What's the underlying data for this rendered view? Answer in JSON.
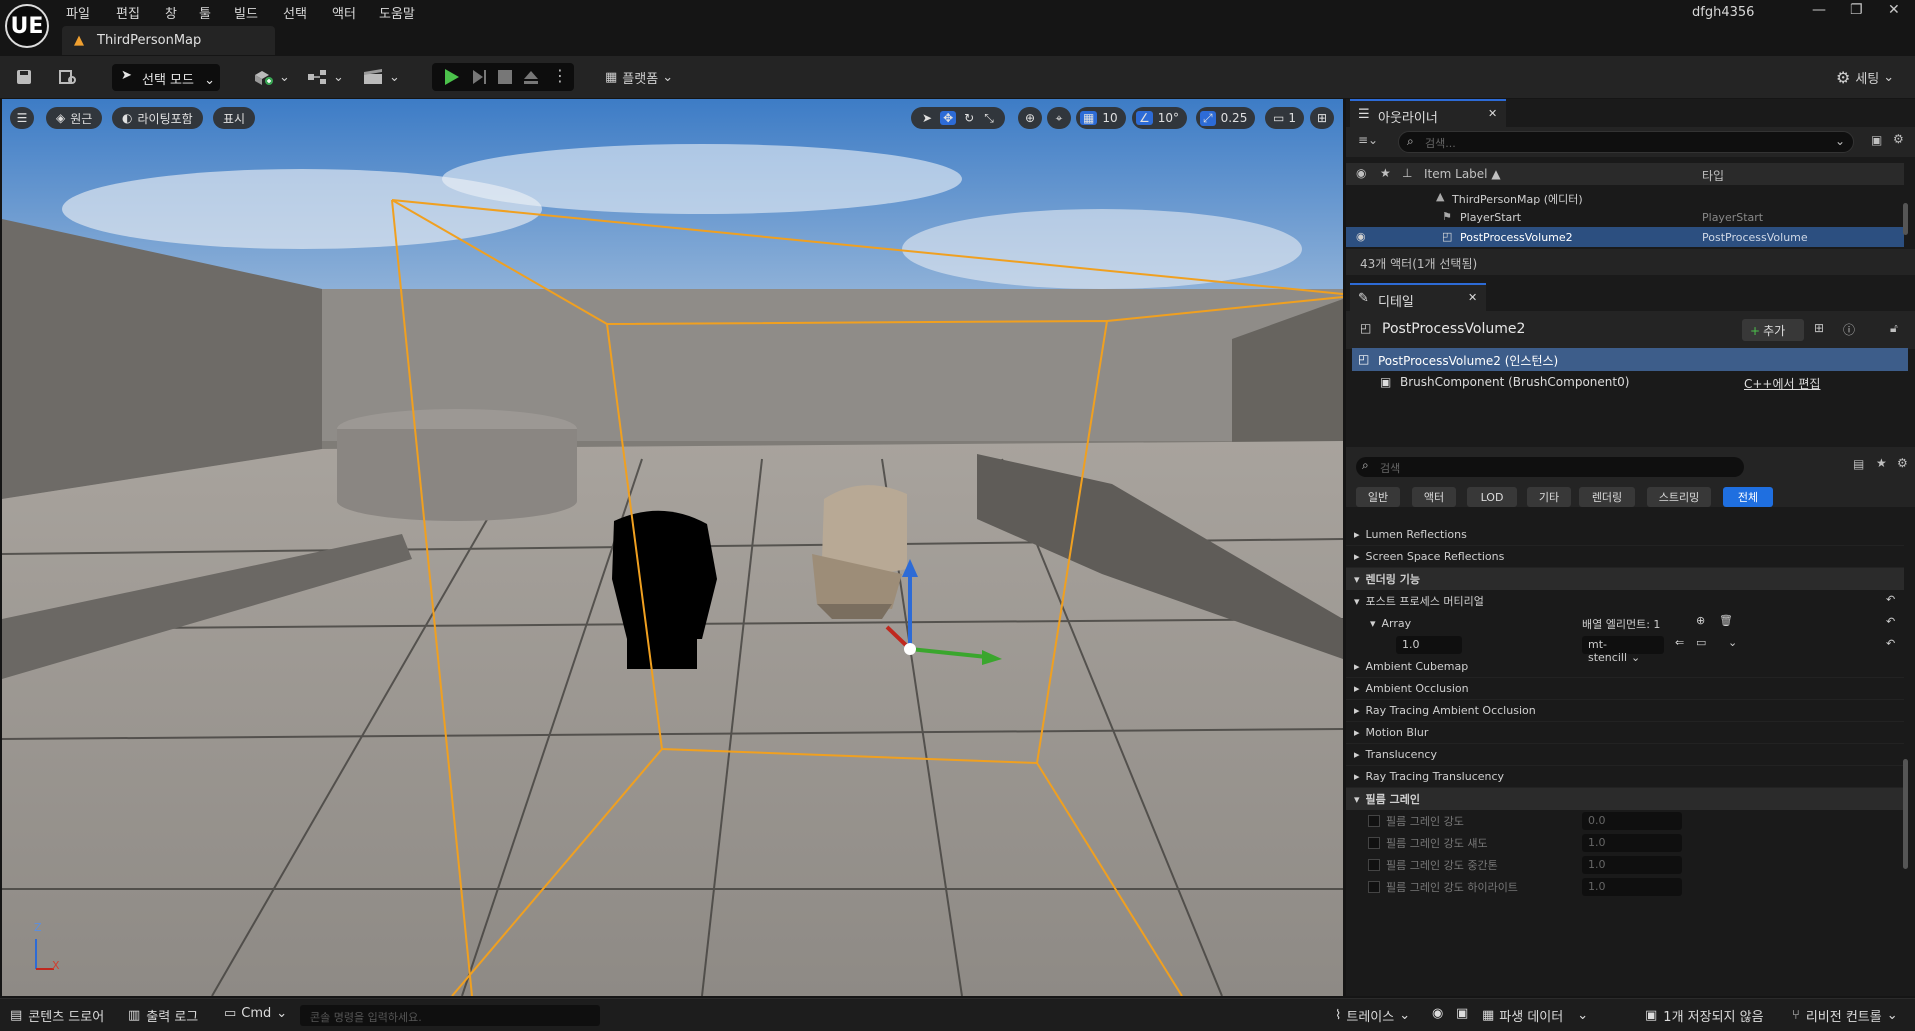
{
  "app": {
    "logo": "UE",
    "menus": [
      "파일",
      "편집",
      "창",
      "툴",
      "빌드",
      "선택",
      "액터",
      "도움말"
    ],
    "user": "dfgh4356",
    "map_tab": "ThirdPersonMap"
  },
  "toolbar": {
    "mode": "선택 모드",
    "platforms": "플랫폼",
    "settings": "세팅"
  },
  "viewport": {
    "perspective": "원근",
    "lit": "라이팅포함",
    "show": "표시",
    "grid_snap": "10",
    "rot_snap": "10°",
    "scale_snap": "0.25",
    "camera_speed": "1",
    "axis_z": "Z",
    "axis_x": "X"
  },
  "outliner": {
    "tab": "아웃라이너",
    "search_placeholder": "검색...",
    "col_label": "Item Label ▲",
    "col_type": "타입",
    "rows": [
      {
        "label": "ThirdPersonMap (에디터)",
        "type": ""
      },
      {
        "label": "PlayerStart",
        "type": "PlayerStart"
      },
      {
        "label": "PostProcessVolume2",
        "type": "PostProcessVolume"
      }
    ],
    "count": "43개 액터(1개 선택됨)"
  },
  "details": {
    "tab": "디테일",
    "object_name": "PostProcessVolume2",
    "add_button": "추가",
    "components": [
      "PostProcessVolume2 (인스턴스)",
      "BrushComponent (BrushComponent0)"
    ],
    "edit_cpp": "C++에서 편집",
    "search_placeholder": "검색",
    "filters": [
      "일반",
      "액터",
      "LOD",
      "기타",
      "렌더링",
      "스트리밍",
      "전체"
    ],
    "props": {
      "lumen": "Lumen Reflections",
      "ssr": "Screen Space Reflections",
      "render_features": "렌더링 기능",
      "pp_materials": "포스트 프로세스 머티리얼",
      "array": "Array",
      "array_elements": "배열 엘리먼트: 1",
      "weight": "1.0",
      "material": "mt-stencill",
      "ambient_cubemap": "Ambient Cubemap",
      "ambient_occlusion": "Ambient Occlusion",
      "rtao": "Ray Tracing Ambient Occlusion",
      "motion_blur": "Motion Blur",
      "translucency": "Translucency",
      "rt_translucency": "Ray Tracing Translucency",
      "film_grain": "필름 그레인",
      "fg_intensity": "필름 그레인 강도",
      "fg_intensity_val": "0.0",
      "fg_shadows": "필름 그레인 강도 섀도",
      "fg_shadows_val": "1.0",
      "fg_mid": "필름 그레인 강도 중간톤",
      "fg_mid_val": "1.0",
      "fg_high": "필름 그레인 강도 하이라이트",
      "fg_high_val": "1.0"
    }
  },
  "statusbar": {
    "content_drawer": "콘텐츠 드로어",
    "output_log": "출력 로그",
    "cmd": "Cmd",
    "console_placeholder": "콘솔 명령을 입력하세요.",
    "trace": "트레이스",
    "derived_data": "파생 데이터",
    "unsaved": "1개 저장되지 않음",
    "revision": "리비전 컨트롤"
  }
}
